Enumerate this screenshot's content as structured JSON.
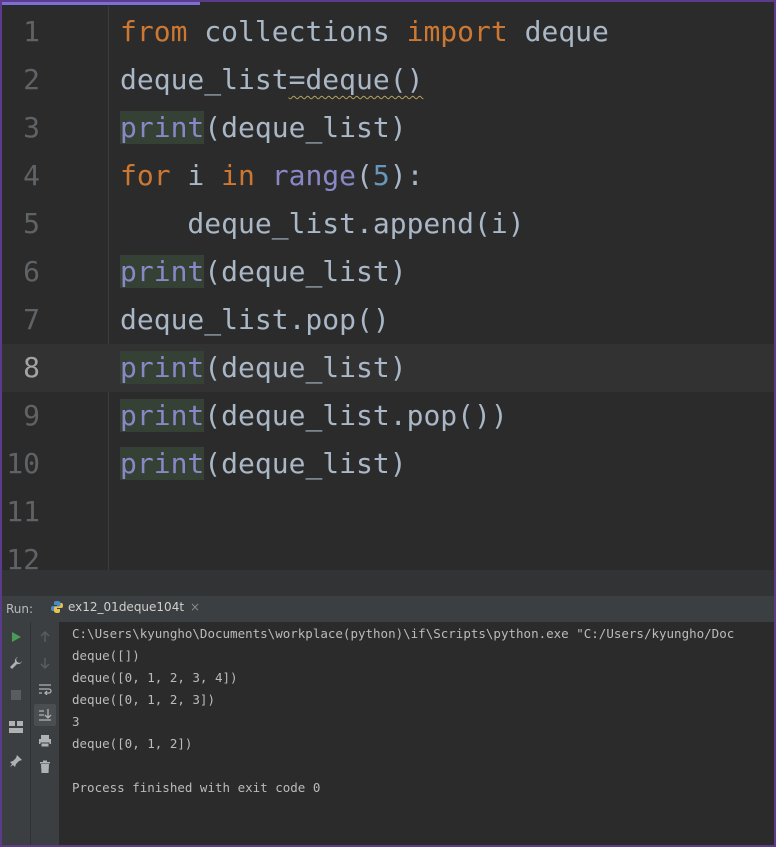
{
  "editor": {
    "lines": [
      {
        "num": "1"
      },
      {
        "num": "2"
      },
      {
        "num": "3"
      },
      {
        "num": "4"
      },
      {
        "num": "5"
      },
      {
        "num": "6"
      },
      {
        "num": "7"
      },
      {
        "num": "8"
      },
      {
        "num": "9"
      },
      {
        "num": "10"
      },
      {
        "num": "11"
      },
      {
        "num": "12"
      }
    ],
    "current_line": "8",
    "code": {
      "l1_from": "from",
      "l1_mod": " collections ",
      "l1_import": "import",
      "l1_name": " deque",
      "l2_a": "deque_list",
      "l2_b": "=deque()",
      "print": "print",
      "l3_rest": "(deque_list)",
      "l4_for": "for",
      "l4_i": " i ",
      "l4_in": "in",
      "l4_sp": " ",
      "l4_range": "range",
      "l4_open": "(",
      "l4_num": "5",
      "l4_close": "):",
      "l5": "    deque_list.append(i)",
      "l6_rest": "(deque_list)",
      "l7": "deque_list.pop()",
      "l8_rest": "(deque_list)",
      "l9_rest": "(deque_list.pop())",
      "l10_rest": "(deque_list)"
    }
  },
  "run_panel": {
    "label": "Run:",
    "tab_name": "ex12_01deque104t",
    "tab_close": "×",
    "icons": {
      "run": "play-icon",
      "wrench": "wrench-icon",
      "stop": "stop-icon",
      "layout": "layout-icon",
      "pin": "pin-icon",
      "up": "arrow-up-icon",
      "down": "arrow-down-icon",
      "soft_wrap": "soft-wrap-icon",
      "scroll_end": "scroll-to-end-icon",
      "print": "print-icon",
      "trash": "trash-icon"
    },
    "console_lines": [
      "C:\\Users\\kyungho\\Documents\\workplace(python)\\if\\Scripts\\python.exe \"C:/Users/kyungho/Doc",
      "deque([])",
      "deque([0, 1, 2, 3, 4])",
      "deque([0, 1, 2, 3])",
      "3",
      "deque([0, 1, 2])",
      "",
      "Process finished with exit code 0"
    ]
  },
  "colors": {
    "keyword": "#cc7832",
    "builtin": "#8888c6",
    "number": "#6897bb",
    "default_text": "#a9b7c6",
    "run_green": "#499c54"
  }
}
